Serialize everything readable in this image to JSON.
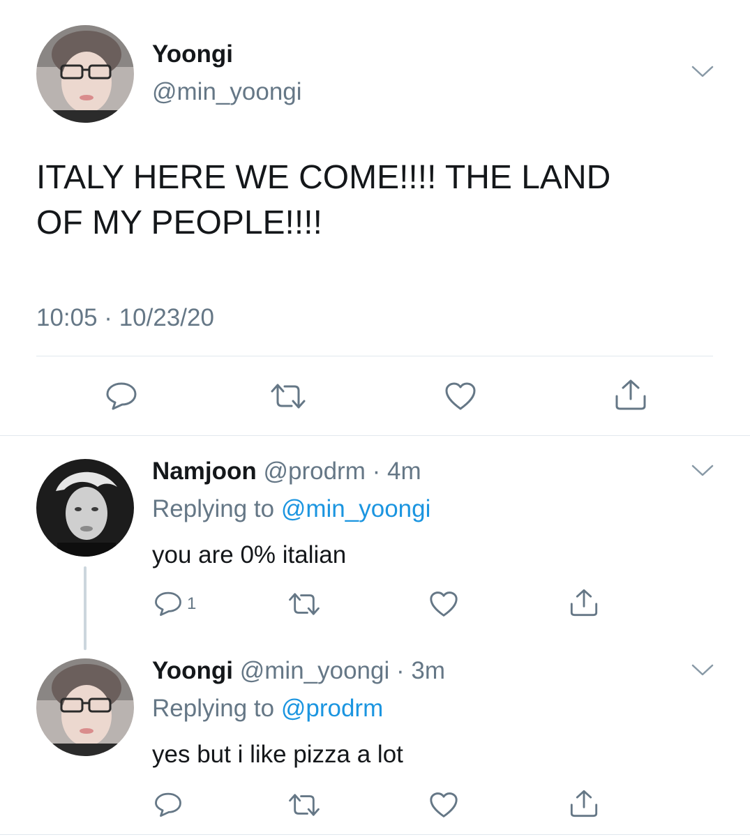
{
  "main_tweet": {
    "author_name": "Yoongi",
    "author_handle": "@min_yoongi",
    "text_line1": "ITALY HERE WE COME!!!! THE LAND",
    "text_line2": "OF MY PEOPLE!!!!",
    "timestamp": "10:05 · 10/23/20"
  },
  "replies": [
    {
      "author_name": "Namjoon",
      "author_handle": "@prodrm",
      "time": "· 4m",
      "replying_prefix": "Replying to",
      "replying_to": "@min_yoongi",
      "text": "you are 0% italian",
      "reply_count": "1"
    },
    {
      "author_name": "Yoongi",
      "author_handle": "@min_yoongi",
      "time": "· 3m",
      "replying_prefix": "Replying to",
      "replying_to": "@prodrm",
      "text": "yes but i like pizza a lot"
    }
  ],
  "colors": {
    "text": "#14171a",
    "muted": "#657786",
    "link": "#1b95e0",
    "divider": "#e1e8ed",
    "icon": "#657786",
    "thread_line": "#ccd6dd"
  }
}
